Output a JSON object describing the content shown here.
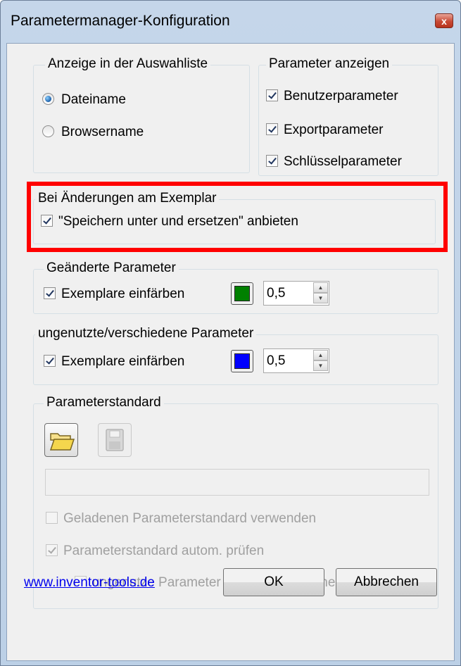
{
  "window": {
    "title": "Parametermanager-Konfiguration",
    "close_label": "x"
  },
  "display_group": {
    "legend": "Anzeige in der Auswahliste",
    "options": [
      {
        "label": "Dateiname",
        "selected": true
      },
      {
        "label": "Browsername",
        "selected": false
      }
    ]
  },
  "show_params_group": {
    "legend": "Parameter anzeigen",
    "items": [
      {
        "label": "Benutzerparameter",
        "checked": true
      },
      {
        "label": "Exportparameter",
        "checked": true
      },
      {
        "label": "Schlüsselparameter",
        "checked": true
      }
    ]
  },
  "changes_group": {
    "legend": "Bei Änderungen am Exemplar",
    "option": {
      "label": "\"Speichern unter und ersetzen\" anbieten",
      "checked": true
    }
  },
  "changed_params_group": {
    "legend": "Geänderte Parameter",
    "color_label": "Exemplare einfärben",
    "checked": true,
    "color": "#008000",
    "value": "0,5"
  },
  "unused_params_group": {
    "legend": "ungenutzte/verschiedene Parameter",
    "color_label": "Exemplare einfärben",
    "checked": true,
    "color": "#0000ff",
    "value": "0,5"
  },
  "standard_group": {
    "legend": "Parameterstandard",
    "open_icon": "folder-open-icon",
    "save_icon": "save-disk-icon",
    "path_value": "",
    "use_loaded_label": "Geladenen Parameterstandard verwenden",
    "auto_check_label": "Parameterstandard autom. prüfen",
    "delete_unused_label": "ungenutze Parameter bei Prüfung löschen"
  },
  "footer": {
    "link": "www.inventor-tools.de",
    "ok_label": "OK",
    "cancel_label": "Abbrechen"
  },
  "colors": {
    "highlight": "#ff0000",
    "title_bar": "#c5d6ea"
  }
}
